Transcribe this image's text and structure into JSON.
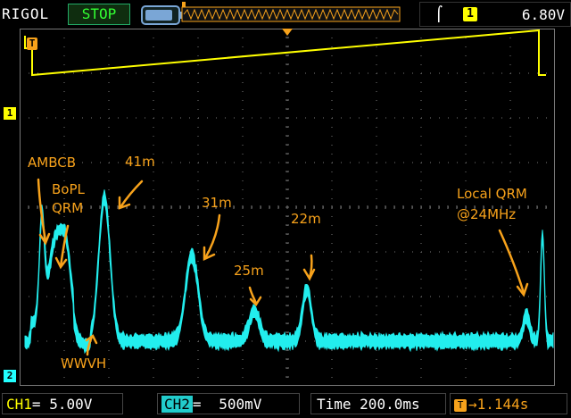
{
  "header": {
    "brand": "RIGOL",
    "run_state": "STOP",
    "trigger_source": "1",
    "trigger_edge_icon": "rising-edge-icon",
    "trigger_level": "6.80V"
  },
  "markers": {
    "trigger": "T",
    "ch1": "1",
    "ch2": "2"
  },
  "annotations": {
    "ambcb": "AMBCB",
    "bopl_line1": "BoPL",
    "bopl_line2": "QRM",
    "wwvh": "WWVH",
    "m41": "41m",
    "m31": "31m",
    "m25": "25m",
    "m22": "22m",
    "local_line1": "Local QRM",
    "local_line2": "@24MHz"
  },
  "footer": {
    "ch1_name": "CH1",
    "ch1_coupling": "=",
    "ch1_scale": "5.00V",
    "ch2_name": "CH2",
    "ch2_coupling": "=",
    "ch2_scale": "500mV",
    "time_label": "Time",
    "time_scale": "200.0ms",
    "trigger_offset": "1.144s",
    "trigger_offset_arrow": "→"
  },
  "colors": {
    "ch1": "#ffff00",
    "ch2": "#22eeee",
    "annotation": "#f7a21b",
    "grid": "#777777"
  }
}
